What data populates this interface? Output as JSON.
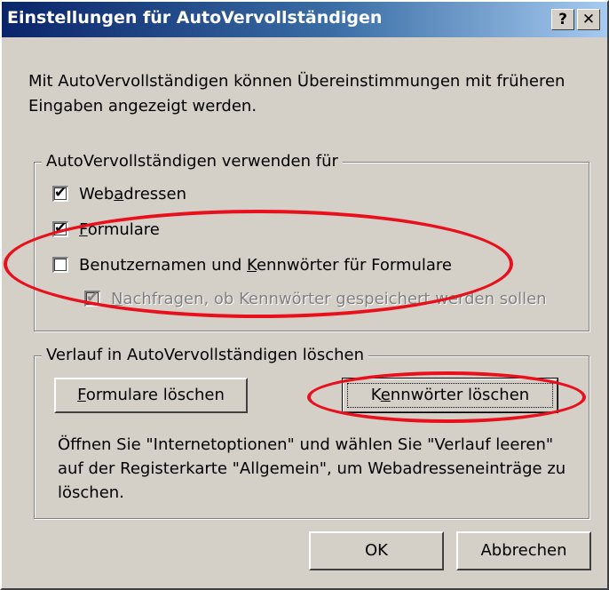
{
  "window": {
    "title": "Einstellungen für AutoVervollständigen",
    "help_label": "?",
    "close_label": "✕"
  },
  "intro_text": "Mit AutoVervollständigen können Übereinstimmungen mit früheren Eingaben angezeigt werden.",
  "usage_group": {
    "legend": "AutoVervollständigen verwenden für",
    "items": [
      {
        "label_pre": "Web",
        "label_ul": "a",
        "label_post": "dressen",
        "checked": true,
        "enabled": true
      },
      {
        "label_pre": "",
        "label_ul": "F",
        "label_post": "ormulare",
        "checked": true,
        "enabled": true
      },
      {
        "label_pre": "Benutzernamen und ",
        "label_ul": "K",
        "label_post": "ennwörter für Formulare",
        "checked": false,
        "enabled": true
      },
      {
        "label_pre": "",
        "label_ul": "N",
        "label_post": "achfragen, ob Kennwörter gespeichert werden sollen",
        "checked": true,
        "enabled": false
      }
    ]
  },
  "history_group": {
    "legend": "Verlauf in AutoVervollständigen löschen",
    "clear_forms": {
      "ul": "F",
      "rest": "ormulare löschen"
    },
    "clear_passwords": {
      "pre": "K",
      "ul": "e",
      "rest": "nnwörter löschen"
    },
    "note": "Öffnen Sie \"Internetoptionen\" und wählen Sie \"Verlauf leeren\" auf der Registerkarte \"Allgemein\", um Webadresseneinträge zu löschen."
  },
  "footer": {
    "ok_label": "OK",
    "cancel_label": "Abbrechen"
  },
  "check_glyph": "✔",
  "colors": {
    "annotation": "#e8101c",
    "titlebar_start": "#0a246a",
    "titlebar_end": "#a6caf0",
    "dialog_face": "#d4d0c8"
  }
}
